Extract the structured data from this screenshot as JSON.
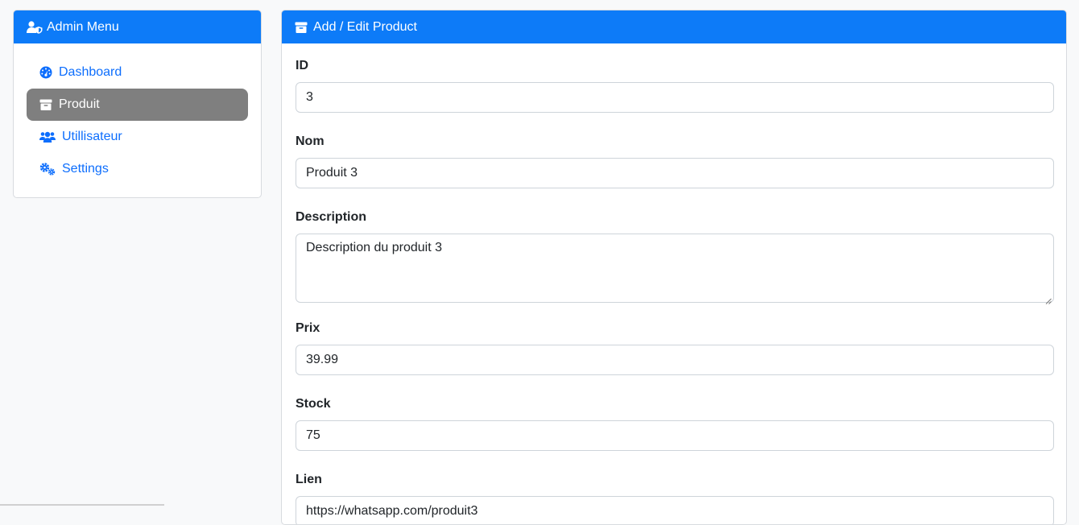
{
  "sidebar": {
    "title": "Admin Menu",
    "items": [
      {
        "label": "Dashboard",
        "icon": "tachometer-icon",
        "active": false
      },
      {
        "label": "Produit",
        "icon": "box-icon",
        "active": true
      },
      {
        "label": "Utillisateur",
        "icon": "users-icon",
        "active": false
      },
      {
        "label": "Settings",
        "icon": "cogs-icon",
        "active": false
      }
    ]
  },
  "main": {
    "title": "Add / Edit Product",
    "fields": {
      "id": {
        "label": "ID",
        "value": "3"
      },
      "nom": {
        "label": "Nom",
        "value": "Produit 3"
      },
      "description": {
        "label": "Description",
        "value": "Description du produit 3"
      },
      "prix": {
        "label": "Prix",
        "value": "39.99"
      },
      "stock": {
        "label": "Stock",
        "value": "75"
      },
      "lien": {
        "label": "Lien",
        "value": "https://whatsapp.com/produit3"
      }
    }
  },
  "colors": {
    "primary": "#0d7bf8",
    "link": "#0d6efd",
    "active_item": "#7f7f7f",
    "background": "#f8f9fa"
  }
}
